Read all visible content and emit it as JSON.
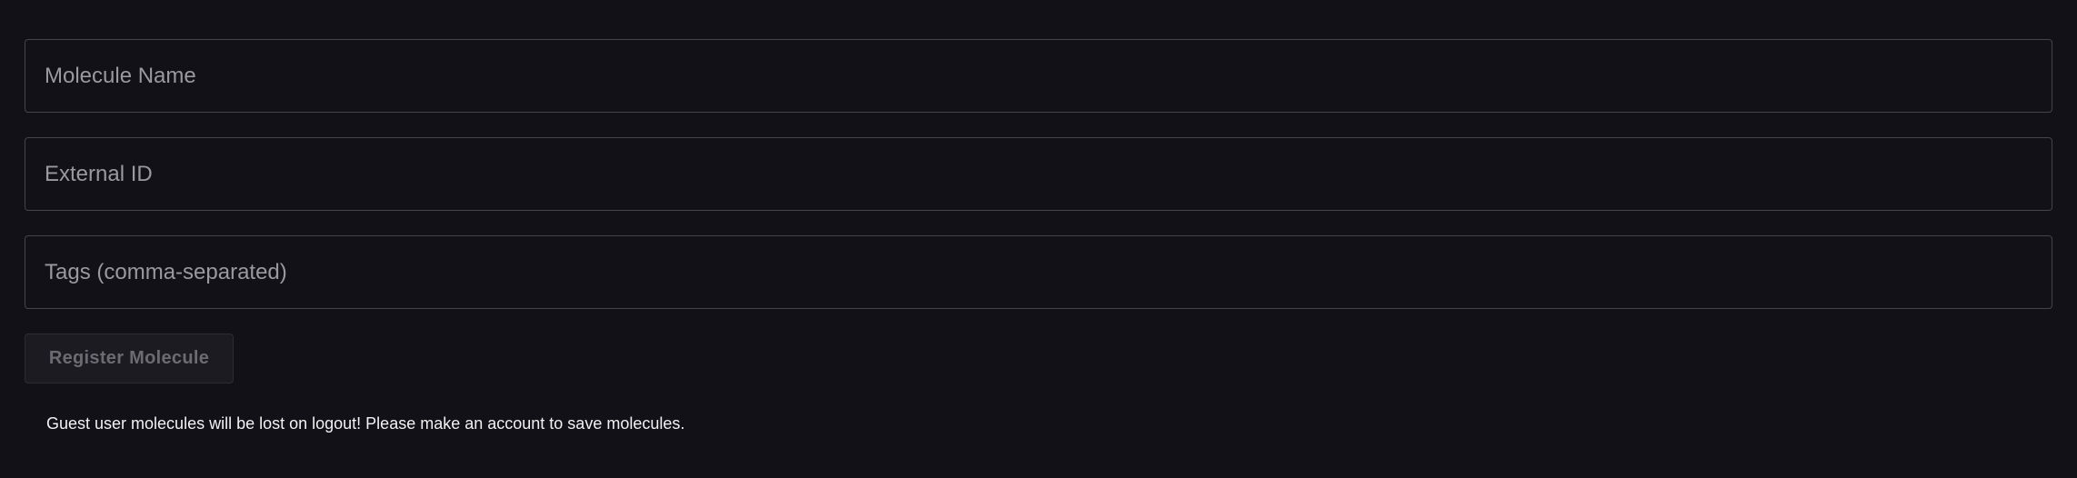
{
  "form": {
    "molecule_name": {
      "value": "",
      "placeholder": "Molecule Name"
    },
    "external_id": {
      "value": "",
      "placeholder": "External ID"
    },
    "tags": {
      "value": "",
      "placeholder": "Tags (comma-separated)"
    },
    "register_button": {
      "label": "Register Molecule",
      "state": "disabled"
    }
  },
  "notice": {
    "text": "Guest user molecules will be lost on logout! Please make an account to save molecules."
  },
  "colors": {
    "background": "#121117",
    "field_border": "#45444b",
    "placeholder": "#9a999f",
    "button_bg": "#1c1b21",
    "button_text": "#6c6b72",
    "notice_text": "#f2f2f4"
  }
}
